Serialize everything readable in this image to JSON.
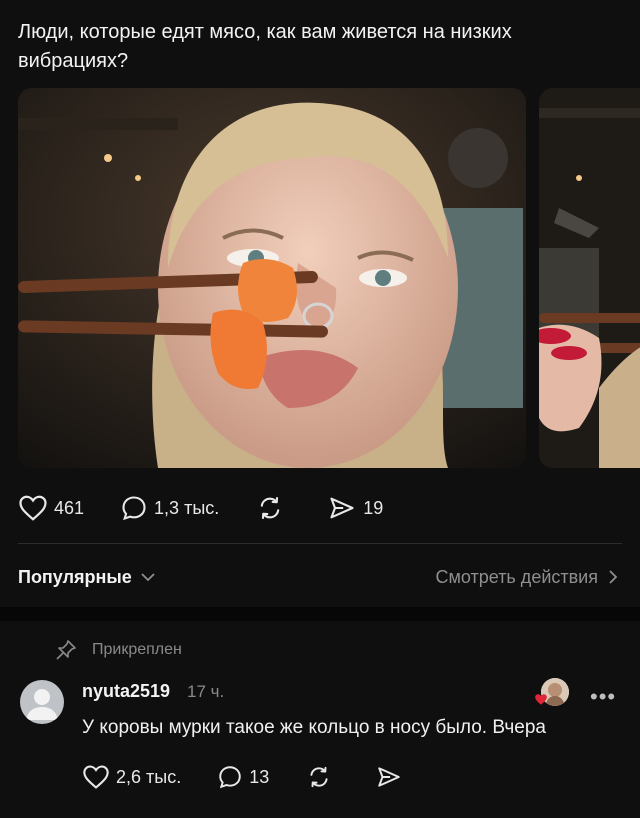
{
  "post": {
    "text": "Люди, которые едят мясо, как вам живется на низких вибрациях?"
  },
  "actions": {
    "likes": "461",
    "comments": "1,3 тыс.",
    "shares": "19"
  },
  "sort": {
    "label": "Популярные",
    "view_actions": "Смотреть действия"
  },
  "comment": {
    "pinned_label": "Прикреплен",
    "username": "nyuta2519",
    "time": "17 ч.",
    "text": "У коровы мурки такое же кольцо в носу было. Вчера",
    "likes": "2,6 тыс.",
    "replies": "13"
  },
  "colors": {
    "background": "#0f0f0f",
    "text": "#f2f2f2",
    "muted": "#8a8a8a",
    "heart": "#e0243a"
  }
}
